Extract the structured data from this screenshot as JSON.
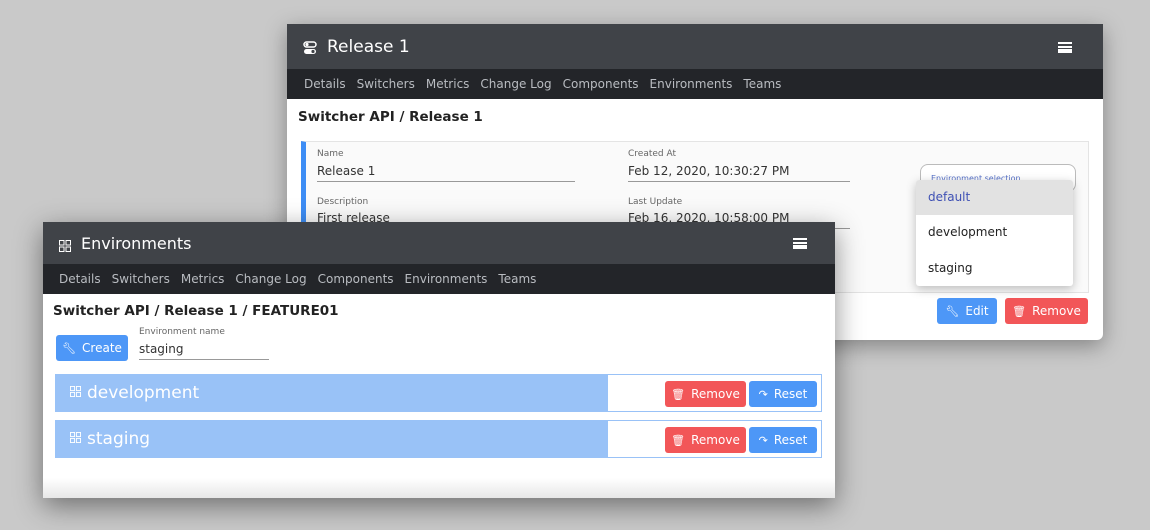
{
  "back_window": {
    "title": "Release 1",
    "nav": [
      "Details",
      "Switchers",
      "Metrics",
      "Change Log",
      "Components",
      "Environments",
      "Teams"
    ],
    "breadcrumb": "Switcher API / Release 1",
    "fields": {
      "name_label": "Name",
      "name_value": "Release 1",
      "created_label": "Created At",
      "created_value": "Feb 12, 2020, 10:30:27 PM",
      "description_label": "Description",
      "description_value": "First release",
      "updated_label": "Last Update",
      "updated_value": "Feb 16, 2020, 10:58:00 PM"
    },
    "env_select_label": "Environment selection",
    "env_options": [
      "default",
      "development",
      "staging"
    ],
    "env_selected": "default",
    "edit_label": "Edit",
    "remove_label": "Remove"
  },
  "front_window": {
    "title": "Environments",
    "nav": [
      "Details",
      "Switchers",
      "Metrics",
      "Change Log",
      "Components",
      "Environments",
      "Teams"
    ],
    "breadcrumb": "Switcher API / Release 1 / FEATURE01",
    "create_label": "Create",
    "env_name_label": "Environment name",
    "env_name_value": "staging",
    "environments": [
      {
        "name": "development",
        "remove_label": "Remove",
        "reset_label": "Reset"
      },
      {
        "name": "staging",
        "remove_label": "Remove",
        "reset_label": "Reset"
      }
    ]
  },
  "colors": {
    "header": "#404348",
    "nav": "#232529",
    "accent_blue": "#4d97f7",
    "danger_red": "#f25658",
    "env_band": "#99c2f7"
  },
  "icons": {
    "release": "toggle-icon",
    "environments": "grid-icon",
    "menu": "hamburger-icon",
    "edit": "wrench-icon",
    "remove": "trash-icon",
    "reset": "reply-arrow-icon"
  }
}
